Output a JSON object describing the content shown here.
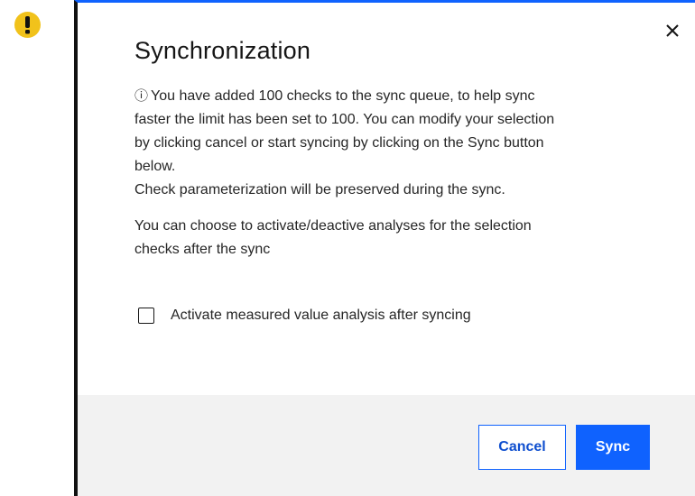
{
  "warning_badge": {
    "icon": "exclamation-icon",
    "color": "#f1c21b"
  },
  "dialog": {
    "title": "Synchronization",
    "close_icon": "close-icon",
    "info_icon_glyph": "ⓘ",
    "message_para1_line1": "You have added 100 checks to the sync queue, to help sync",
    "message_para1_line2": "faster the limit has been set to 100. You can modify your selection",
    "message_para1_line3": "by clicking cancel or start syncing by clicking on the Sync button",
    "message_para1_line4": "below.",
    "message_para2": "Check parameterization will be preserved during the sync.",
    "message_para3_line1": "You can choose to activate/deactive analyses for the selection",
    "message_para3_line2": "checks after the sync",
    "checkbox_label": "Activate measured value analysis after syncing",
    "checkbox_checked": false
  },
  "footer": {
    "cancel_label": "Cancel",
    "sync_label": "Sync"
  },
  "colors": {
    "accent": "#0f62fe",
    "footer_bg": "#f2f2f2",
    "text": "#262626"
  }
}
